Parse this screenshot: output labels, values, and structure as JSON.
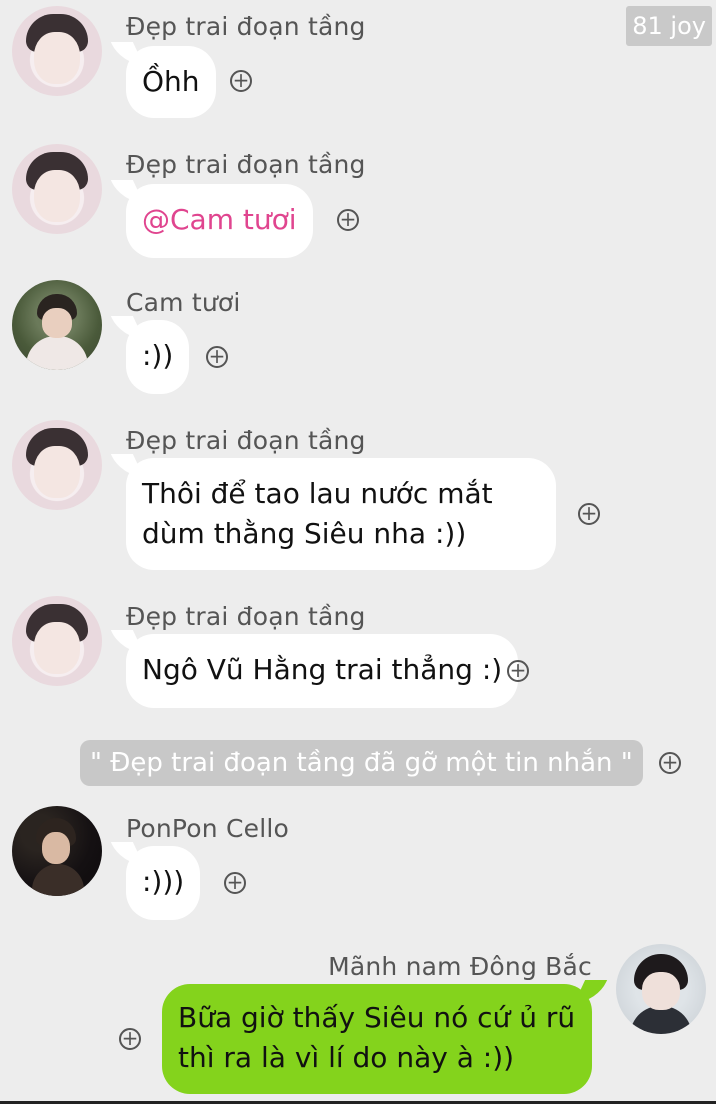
{
  "watermark": "81 joy",
  "messages": [
    {
      "sender": "Đẹp trai đoạn tầng",
      "text": "Ồhh"
    },
    {
      "sender": "Đẹp trai đoạn tầng",
      "text": "@Cam tươi"
    },
    {
      "sender": "Cam tươi",
      "text": ":))"
    },
    {
      "sender": "Đẹp trai đoạn tầng",
      "lines": [
        "Thôi để tao lau nước mắt",
        "dùm thằng Siêu nha :))"
      ]
    },
    {
      "sender": "Đẹp trai đoạn tầng",
      "text": "Ngô Vũ Hằng trai thẳng :)"
    },
    {
      "system": "\" Đẹp trai đoạn tầng đã gỡ một tin nhắn \""
    },
    {
      "sender": "PonPon Cello",
      "text": ":)))"
    },
    {
      "sender": "Mãnh nam Đông Bắc",
      "lines": [
        "Bữa giờ thấy Siêu nó cứ ủ rũ",
        "thì ra là vì lí do này à :))"
      ]
    }
  ],
  "icons": {
    "reaction": "plus-circle-icon"
  },
  "colors": {
    "background": "#ededed",
    "outgoing_bubble": "#84d31c",
    "mention": "#e0458f"
  }
}
